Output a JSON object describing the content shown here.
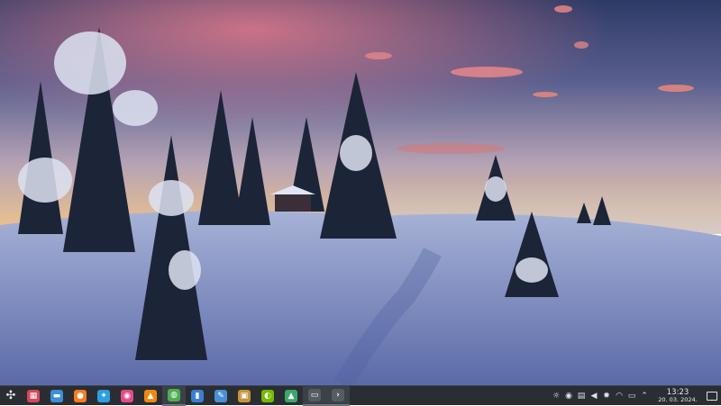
{
  "wallpaper": {
    "icon": "snowy-forest-sunset-wallpaper"
  },
  "taskbar": {
    "launcher_icon": "kde-launcher-icon",
    "apps": [
      {
        "name": "system-monitor",
        "glyph": "▦",
        "color": "#d4475c",
        "active": false
      },
      {
        "name": "file-manager",
        "glyph": "▬",
        "color": "#3d8fd6",
        "active": false
      },
      {
        "name": "firefox",
        "glyph": "●",
        "color": "#ff7a1a",
        "active": false
      },
      {
        "name": "discover",
        "glyph": "✦",
        "color": "#2b9fe0",
        "active": false
      },
      {
        "name": "recorder",
        "glyph": "◉",
        "color": "#e24b8a",
        "active": false
      },
      {
        "name": "vlc",
        "glyph": "▲",
        "color": "#f2880f",
        "active": false
      },
      {
        "name": "chrome",
        "glyph": "◍",
        "color": "#4caf50",
        "active": true
      },
      {
        "name": "text-editor",
        "glyph": "▮",
        "color": "#3b7ed6",
        "active": false
      },
      {
        "name": "kdenlive",
        "glyph": "✎",
        "color": "#4a90d9",
        "active": false
      },
      {
        "name": "archive-tool",
        "glyph": "▣",
        "color": "#c8953a",
        "active": false
      },
      {
        "name": "nvidia-settings",
        "glyph": "◐",
        "color": "#76b900",
        "active": false
      },
      {
        "name": "system-graph",
        "glyph": "▲",
        "color": "#3aa86b",
        "active": false
      },
      {
        "name": "terminal-a",
        "glyph": "▭",
        "color": "#555c63",
        "active": true
      },
      {
        "name": "terminal-b",
        "glyph": "›",
        "color": "#555c63",
        "active": true
      }
    ],
    "tray": [
      {
        "name": "brightness-icon",
        "glyph": "☼"
      },
      {
        "name": "record-icon",
        "glyph": "◉"
      },
      {
        "name": "clipboard-icon",
        "glyph": "▤"
      },
      {
        "name": "volume-icon",
        "glyph": "◀"
      },
      {
        "name": "settings-icon",
        "glyph": "✹"
      },
      {
        "name": "wifi-icon",
        "glyph": "◠"
      },
      {
        "name": "battery-icon",
        "glyph": "▭"
      },
      {
        "name": "expand-tray-icon",
        "glyph": "⌃"
      }
    ],
    "clock": {
      "time": "13:23",
      "date": "20. 03. 2024."
    }
  }
}
